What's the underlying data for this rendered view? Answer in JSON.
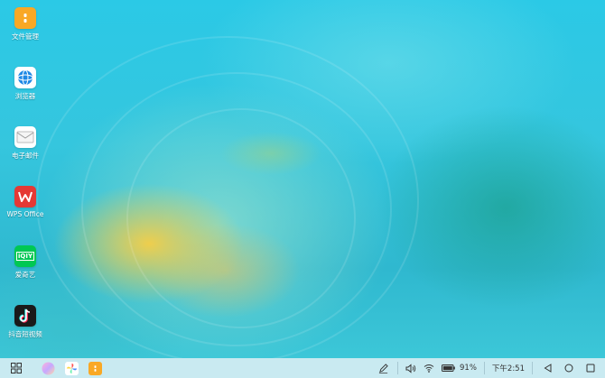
{
  "desktop": {
    "icons": [
      {
        "label": "文件管理",
        "icon": "file-manager-icon",
        "color": "#f9a825"
      },
      {
        "label": "浏览器",
        "icon": "browser-globe-icon",
        "color": "#1e88e5"
      },
      {
        "label": "电子邮件",
        "icon": "envelope-icon",
        "color": "#ffffff"
      },
      {
        "label": "WPS Office",
        "icon": "wps-office-icon",
        "color": "#e53935"
      },
      {
        "label": "爱奇艺",
        "icon": "iqiyi-icon",
        "color": "#00c853",
        "logo_text": "iQIY"
      },
      {
        "label": "抖音短视频",
        "icon": "tiktok-icon",
        "color": "#1a1a1a"
      }
    ]
  },
  "taskbar": {
    "start_icon": "app-grid-icon",
    "pinned": [
      {
        "name": "assistant-orb-icon"
      },
      {
        "name": "gallery-pinwheel-icon"
      },
      {
        "name": "file-manager-icon"
      }
    ],
    "tray": {
      "pen_icon": "stylus-icon",
      "volume_icon": "volume-icon",
      "wifi_icon": "wifi-icon",
      "battery_icon": "battery-icon",
      "battery_text": "91%",
      "time": "下午2:51"
    },
    "nav": [
      "back-triangle-icon",
      "home-circle-icon",
      "recents-square-icon"
    ]
  }
}
